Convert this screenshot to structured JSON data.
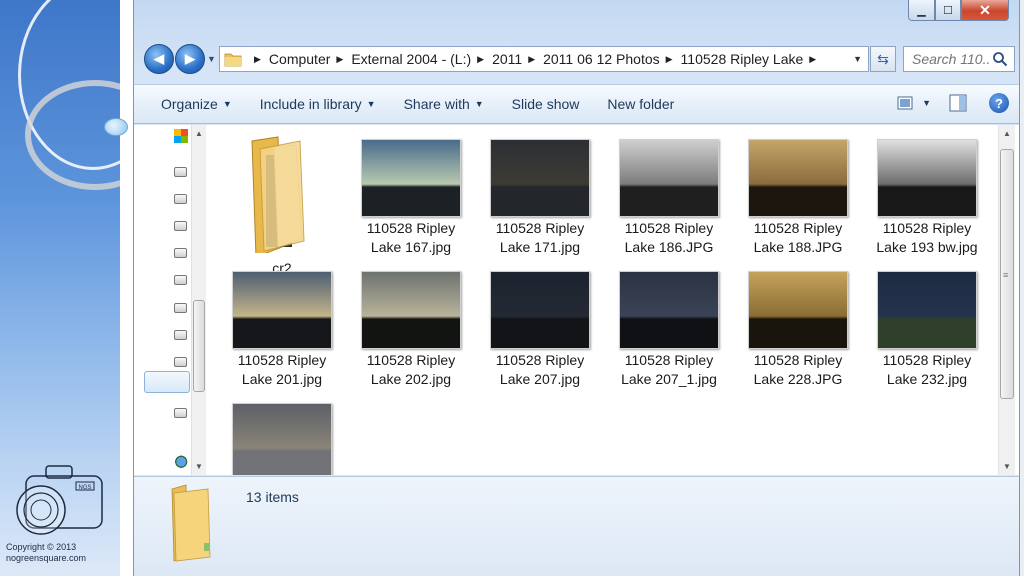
{
  "window": {
    "caption": {
      "minimize": "▁",
      "maximize": "☐",
      "close": "✕"
    }
  },
  "navigation": {
    "back_icon": "◀",
    "forward_icon": "▶",
    "recent_dropdown": "▼"
  },
  "address_bar": {
    "breadcrumbs": [
      "Computer",
      "External 2004 - (L:)",
      "2011",
      "2011 06 12 Photos",
      "110528 Ripley Lake"
    ],
    "separator": "▶",
    "dropdown": "▼",
    "refresh_icon": "⇆"
  },
  "search": {
    "placeholder": "Search 110..."
  },
  "toolbar": {
    "organize": "Organize",
    "include_in_library": "Include in library",
    "share_with": "Share with",
    "slide_show": "Slide show",
    "new_folder": "New folder",
    "dropdown_arrow": "▼",
    "help": "?"
  },
  "files": [
    {
      "type": "folder",
      "label": "cr2",
      "colors": [
        "#f5d68a",
        "#e8b84a"
      ]
    },
    {
      "type": "image",
      "label": "110528 Ripley Lake 167.jpg",
      "colors": [
        "#4a6b8a",
        "#b8c9b0",
        "#1c2126"
      ]
    },
    {
      "type": "image",
      "label": "110528 Ripley Lake 171.jpg",
      "colors": [
        "#2c2f33",
        "#3d3b34",
        "#23262a"
      ]
    },
    {
      "type": "image",
      "label": "110528 Ripley Lake 186.JPG",
      "colors": [
        "#cfcfcf",
        "#7c7c7c",
        "#1f1f1f"
      ]
    },
    {
      "type": "image",
      "label": "110528 Ripley Lake 188.JPG",
      "colors": [
        "#c5a56a",
        "#8a6b3c",
        "#1c160e"
      ]
    },
    {
      "type": "image",
      "label": "110528 Ripley Lake 193 bw.jpg",
      "colors": [
        "#e0e0e0",
        "#6c6c6c",
        "#181818"
      ]
    },
    {
      "type": "image",
      "label": "110528 Ripley Lake 201.jpg",
      "colors": [
        "#4e5e72",
        "#c4b58a",
        "#15171a"
      ]
    },
    {
      "type": "image",
      "label": "110528 Ripley Lake 202.jpg",
      "colors": [
        "#6e7270",
        "#b8b39a",
        "#121411"
      ]
    },
    {
      "type": "image",
      "label": "110528 Ripley Lake 207.jpg",
      "colors": [
        "#1d232e",
        "#242a34",
        "#121418"
      ]
    },
    {
      "type": "image",
      "label": "110528 Ripley Lake 207_1.jpg",
      "colors": [
        "#2a3242",
        "#3b4357",
        "#0f1115"
      ]
    },
    {
      "type": "image",
      "label": "110528 Ripley Lake 228.JPG",
      "colors": [
        "#c5a35c",
        "#8b6d33",
        "#19150c"
      ]
    },
    {
      "type": "image",
      "label": "110528 Ripley Lake 232.jpg",
      "colors": [
        "#1c2a42",
        "#25344c",
        "#2f3f2a"
      ]
    },
    {
      "type": "image",
      "label": "",
      "colors": [
        "#5d6068",
        "#8a8478",
        "#707278"
      ]
    }
  ],
  "details": {
    "items_count": "13 items"
  },
  "slide": {
    "copyright_line1": "Copyright © 2013",
    "copyright_line2": "nogreensquare.com",
    "logo_text": "NGS"
  },
  "colors": {
    "accent": "#1e395b",
    "window_frame": "#c2d8f2",
    "close_red": "#c9462c"
  }
}
